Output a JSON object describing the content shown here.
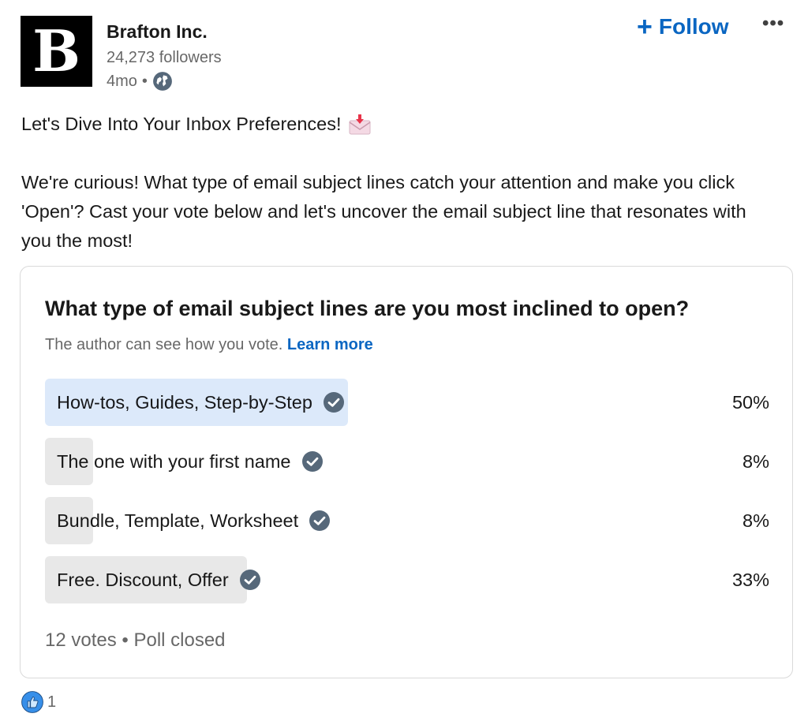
{
  "author": {
    "logo_letter": "B",
    "name": "Brafton Inc.",
    "followers": "24,273 followers",
    "time": "4mo",
    "separator": "•",
    "visibility_icon": "globe-icon"
  },
  "actions": {
    "follow_label": "Follow",
    "follow_icon": "plus-icon",
    "more_label": "•••"
  },
  "post": {
    "line1": "Let's Dive Into Your Inbox Preferences!",
    "line1_icon": "incoming-envelope-icon",
    "paragraph": "We're curious! What type of email subject lines catch your attention and make you click 'Open'? Cast your vote below and let's uncover the email subject line that resonates with you the most!"
  },
  "poll": {
    "question": "What type of email subject lines are you most inclined to open?",
    "note": "The author can see how you vote.",
    "learn_more": "Learn more",
    "options": [
      {
        "label": "How-tos, Guides, Step-by-Step",
        "percent": "50%",
        "fraction": 0.5,
        "voted": true
      },
      {
        "label": "The one with your first name",
        "percent": "8%",
        "fraction": 0.08,
        "voted": false
      },
      {
        "label": "Bundle, Template, Worksheet",
        "percent": "8%",
        "fraction": 0.08,
        "voted": false
      },
      {
        "label": "Free. Discount, Offer",
        "percent": "33%",
        "fraction": 0.33,
        "voted": false
      }
    ],
    "footer": "12 votes • Poll closed"
  },
  "reactions": {
    "icon": "like-icon",
    "count": "1"
  },
  "colors": {
    "accent": "#0a66c2",
    "voted_fill": "#dce9fa",
    "option_fill": "#e8e8e8",
    "check": "#56687a"
  }
}
